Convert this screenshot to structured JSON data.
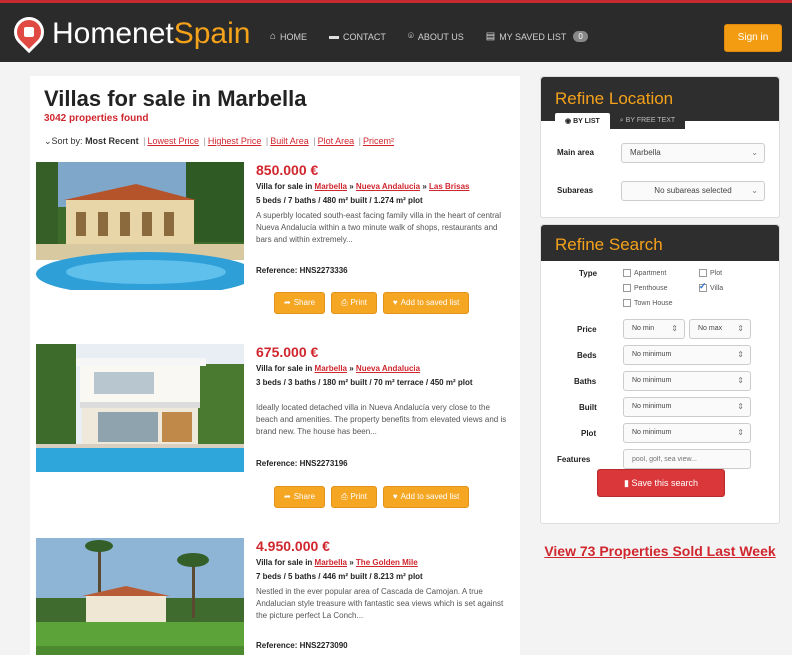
{
  "header": {
    "logo_white": "Homenet",
    "logo_orange": "Spain",
    "nav": [
      {
        "icon": "home-icon",
        "label": "HOME"
      },
      {
        "icon": "chat-icon",
        "label": "CONTACT"
      },
      {
        "icon": "pin-icon",
        "label": "ABOUT US"
      },
      {
        "icon": "list-icon",
        "label": "MY SAVED LIST",
        "badge": "0"
      }
    ],
    "signin_label": "Sign in"
  },
  "main": {
    "title": "Villas for sale in Marbella",
    "found": "3042 properties found",
    "sort_prefix": "Sort by: ",
    "sort_current": "Most Recent",
    "sort_links": [
      "Lowest Price",
      "Highest Price",
      "Built Area",
      "Plot Area",
      "Pricem²"
    ]
  },
  "listings": [
    {
      "price": "850.000 €",
      "type": "Villa for sale in ",
      "loc": [
        "Marbella",
        "Nueva Andalucia",
        "Las Brisas"
      ],
      "specs": "5 beds / 7 baths / 480 m² built / 1.274 m² plot",
      "desc": "A superbly located south-east facing family villa in the heart of central Nueva Andalucía within a two minute walk of shops, restaurants and bars and within extremely...",
      "ref": "Reference: HNS2273336"
    },
    {
      "price": "675.000 €",
      "type": "Villa for sale in ",
      "loc": [
        "Marbella",
        "Nueva Andalucia"
      ],
      "specs": "3 beds / 3 baths / 180 m² built / 70 m² terrace / 450 m² plot",
      "desc": "Ideally located detached villa in Nueva Andalucía very close to the beach and amenities. The property benefits from elevated views and is brand new. The house has been...",
      "ref": "Reference: HNS2273196"
    },
    {
      "price": "4.950.000 €",
      "type": "Villa for sale in ",
      "loc": [
        "Marbella",
        "The Golden Mile"
      ],
      "specs": "7 beds / 5 baths / 446 m² built / 8.213 m² plot",
      "desc": "Nestled in the ever popular area of Cascada de Camojan. A true Andalucian style treasure with fantastic sea views which is set against the picture perfect La Conch...",
      "ref": "Reference: HNS2273090"
    }
  ],
  "actions": {
    "share": "Share",
    "print": "Print",
    "save": "Add to saved list"
  },
  "location_panel": {
    "title": "Refine Location",
    "tab_list": "BY LIST",
    "tab_text": "BY FREE TEXT",
    "main_area_label": "Main area",
    "main_area_value": "Marbella",
    "subareas_label": "Subareas",
    "subareas_value": "No subareas selected"
  },
  "search_panel": {
    "title": "Refine Search",
    "type_label": "Type",
    "types": [
      "Apartment",
      "Plot",
      "Penthouse",
      "Villa",
      "Town House"
    ],
    "type_checked": "Villa",
    "price_label": "Price",
    "price_min": "No min",
    "price_max": "No max",
    "beds_label": "Beds",
    "baths_label": "Baths",
    "built_label": "Built",
    "plot_label": "Plot",
    "no_minimum": "No minimum",
    "features_label": "Features",
    "features_placeholder": "pool, golf, sea view...",
    "save_search": "Save this search"
  },
  "sold_link": "View 73 Properties Sold Last Week"
}
